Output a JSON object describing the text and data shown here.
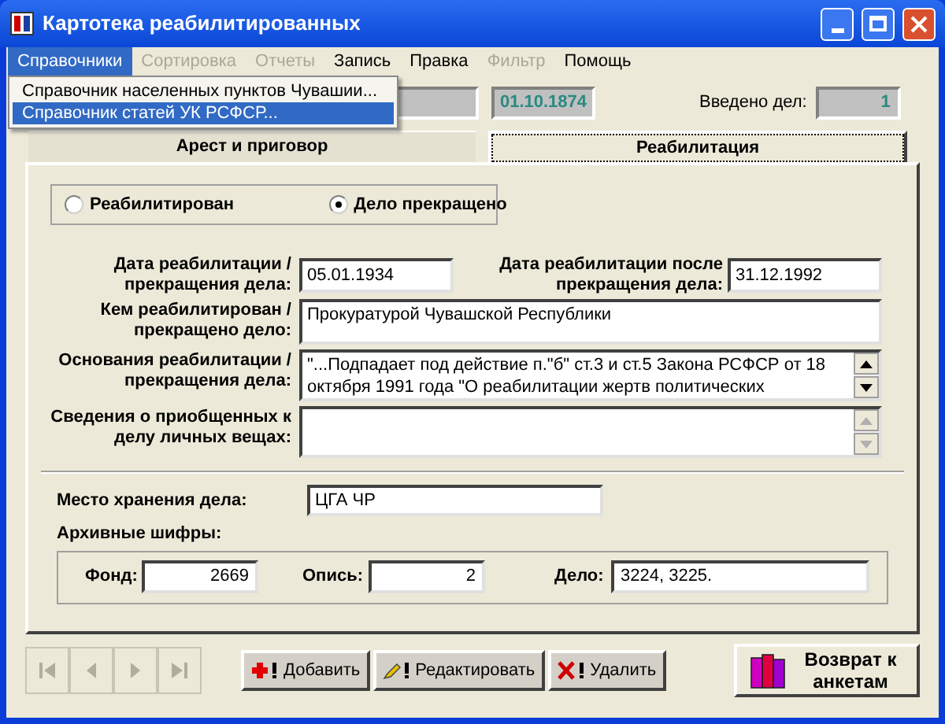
{
  "window": {
    "title": "Картотека реабилитированных"
  },
  "menu": [
    {
      "label": "Справочники",
      "selected": true,
      "disabled": false
    },
    {
      "label": "Сортировка",
      "selected": false,
      "disabled": true
    },
    {
      "label": "Отчеты",
      "selected": false,
      "disabled": true
    },
    {
      "label": "Запись",
      "selected": false,
      "disabled": false
    },
    {
      "label": "Правка",
      "selected": false,
      "disabled": false
    },
    {
      "label": "Фильтр",
      "selected": false,
      "disabled": true
    },
    {
      "label": "Помощь",
      "selected": false,
      "disabled": false
    }
  ],
  "dropdown": [
    {
      "label": "Справочник населенных пунктов Чувашии...",
      "selected": false
    },
    {
      "label": "Справочник статей УК РСФСР...",
      "selected": true
    }
  ],
  "header": {
    "date": "01.10.1874",
    "count_label": "Введено дел:",
    "count": "1"
  },
  "tabs": [
    {
      "label": "Арест и приговор",
      "selected": false
    },
    {
      "label": "Реабилитация",
      "selected": true
    }
  ],
  "status_options": [
    {
      "label": "Реабилитирован",
      "selected": false
    },
    {
      "label": "Дело прекращено",
      "selected": true
    }
  ],
  "dates": {
    "label": "Дата реабилитации / прекращения дела:",
    "value": "05.01.1934",
    "after_label": "Дата реабилитации после прекращения дела:",
    "after_value": "31.12.1992"
  },
  "fields": [
    {
      "label": "Кем реабилитирован / прекращено дело:",
      "value": "Прокуратурой Чувашской Республики",
      "kind": "text"
    },
    {
      "label": "Основания реабилитации / прекращения дела:",
      "value": "\"...Подпадает под действие п.\"б\" ст.3 и ст.5 Закона РСФСР от 18 октября 1991 года \"О реабилитации жертв политических",
      "kind": "scroll",
      "disabled": false
    },
    {
      "label": "Сведения о приобщенных к делу личных вещах:",
      "kind": "scroll",
      "disabled": true
    }
  ],
  "storage": {
    "label": "Место хранения дела:",
    "value": "ЦГА ЧР"
  },
  "archive": {
    "label": "Архивные шифры:",
    "fond_label": "Фонд:",
    "fond": "2669",
    "opis_label": "Опись:",
    "opis": "2",
    "delo_label": "Дело:",
    "delo": "3224, 3225."
  },
  "actions": [
    {
      "label": "Добавить",
      "kind": "add"
    },
    {
      "label": "Редактировать",
      "kind": "edit"
    },
    {
      "label": "Удалить",
      "kind": "delete"
    }
  ],
  "return_button": {
    "label": "Возврат к анкетам"
  }
}
